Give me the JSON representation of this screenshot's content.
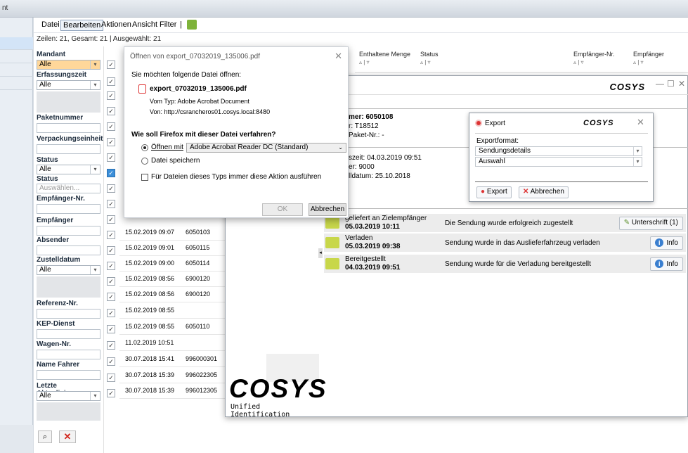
{
  "top_strip": {
    "text": "nt"
  },
  "menu": {
    "items": [
      "Datei",
      "Bearbeiten",
      "Aktionen",
      "Ansicht",
      "Filter"
    ],
    "separator": "|"
  },
  "status": {
    "text": "Zeilen: 21, Gesamt: 21  |  Ausgewählt: 21"
  },
  "filters": {
    "mandant": {
      "label": "Mandant",
      "value": "Alle"
    },
    "erfassungszeit": {
      "label": "Erfassungszeit",
      "value": "Alle"
    },
    "paketnummer": {
      "label": "Paketnummer"
    },
    "verpackungseinheit": {
      "label": "Verpackungseinheit"
    },
    "status1": {
      "label": "Status",
      "value": "Alle"
    },
    "status2": {
      "label": "Status",
      "placeholder": "Auswählen..."
    },
    "empfaenger_nr": {
      "label": "Empfänger-Nr."
    },
    "empfaenger": {
      "label": "Empfänger"
    },
    "absender": {
      "label": "Absender"
    },
    "zustelldatum": {
      "label": "Zustelldatum",
      "value": "Alle"
    },
    "referenz": {
      "label": "Referenz-Nr."
    },
    "kep": {
      "label": "KEP-Dienst"
    },
    "wagen": {
      "label": "Wagen-Nr."
    },
    "fahrer": {
      "label": "Name Fahrer"
    },
    "aktualisierung": {
      "label": "Letzte Aktualisierung",
      "value": "Alle"
    }
  },
  "grid": {
    "headers": [
      {
        "label": "Enthaltene Menge",
        "sort": "▵ | ▿"
      },
      {
        "label": "Status",
        "sort": "▵ | ▿"
      },
      {
        "label": "Empfänger-Nr.",
        "sort": "▵ | ▿"
      },
      {
        "label": "Empfänger",
        "sort": "▵ | ▿"
      }
    ],
    "rows": [
      {
        "date": "15.02.2019 09:07",
        "nr": "6050103"
      },
      {
        "date": "15.02.2019 09:01",
        "nr": "6050115"
      },
      {
        "date": "15.02.2019 09:00",
        "nr": "6050114"
      },
      {
        "date": "15.02.2019 08:56",
        "nr": "6900120"
      },
      {
        "date": "15.02.2019 08:56",
        "nr": "6900120"
      },
      {
        "date": "15.02.2019 08:55",
        "nr": ""
      },
      {
        "date": "15.02.2019 08:55",
        "nr": "6050110"
      },
      {
        "date": "11.02.2019 10:51",
        "nr": ""
      },
      {
        "date": "30.07.2018 15:41",
        "nr": "996000301"
      },
      {
        "date": "30.07.2018 15:39",
        "nr": "996022305"
      },
      {
        "date": "30.07.2018 15:39",
        "nr": "996012305"
      }
    ]
  },
  "detail": {
    "logo": "COSYS",
    "paket_line1": "mer: 6050108",
    "paket_line2": "r: T18512",
    "paket_line3": "Paket-Nr.: -",
    "info_line1": "szeit: 04.03.2019 09:51",
    "info_line2": "er: 9000",
    "info_line3": "lldatum: 25.10.2018",
    "events": [
      {
        "title": "geliefert an Zielempfänger",
        "time": "05.03.2019 10:11",
        "desc": "Die Sendung wurde erfolgreich zugestellt",
        "button": "Unterschrift (1)"
      },
      {
        "title": "Verladen",
        "time": "05.03.2019 09:38",
        "desc": "Sendung wurde in das Auslieferfahrzeug verladen",
        "button": "Info"
      },
      {
        "title": "Bereitgestellt",
        "time": "04.03.2019 09:51",
        "desc": "Sendung wurde für die Verladung bereitgestellt",
        "button": "Info"
      }
    ],
    "big_logo": "COSYS",
    "big_logo_sub": "Unified Identification"
  },
  "export": {
    "title": "Export",
    "logo": "COSYS",
    "format_label": "Exportformat:",
    "format_value": "Sendungsdetails",
    "selection_value": "Auswahl",
    "export_button": "Export",
    "cancel_button": "Abbrechen"
  },
  "firefox": {
    "title": "Öffnen von export_07032019_135006.pdf",
    "question": "Sie möchten folgende Datei öffnen:",
    "filename": "export_07032019_135006.pdf",
    "type": "Vom Typ: Adobe Acrobat Document",
    "from": "Von: http://csrancheros01.cosys.local:8480",
    "prompt": "Wie soll Firefox mit dieser Datei verfahren?",
    "open_with": "Öffnen mit",
    "app": "Adobe Acrobat Reader DC  (Standard)",
    "save": "Datei speichern",
    "always": "Für Dateien dieses Typs immer diese Aktion ausführen",
    "ok": "OK",
    "cancel": "Abbrechen"
  },
  "colors": {
    "accent": "#3c8fd9",
    "filter_highlight": "#ffd79a",
    "event_bg": "#ececec"
  }
}
